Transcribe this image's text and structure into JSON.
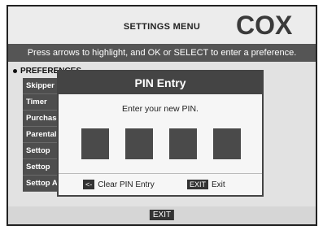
{
  "header": {
    "title": "SETTINGS MENU",
    "logo": "COX"
  },
  "instructions": "Press arrows to highlight, and OK or SELECT to enter a preference.",
  "preferences": {
    "label": "PREFERENCES",
    "items": [
      "Skipper",
      "Timer",
      "Purchase",
      "Parental",
      "Settop",
      "Settop",
      "Settop AC Outlet"
    ]
  },
  "dialog": {
    "title": "PIN Entry",
    "prompt": "Enter your new PIN.",
    "clear_key": "<-",
    "clear_label": "Clear PIN Entry",
    "exit_key": "EXIT",
    "exit_label": "Exit"
  },
  "footer": {
    "exit": "EXIT"
  }
}
